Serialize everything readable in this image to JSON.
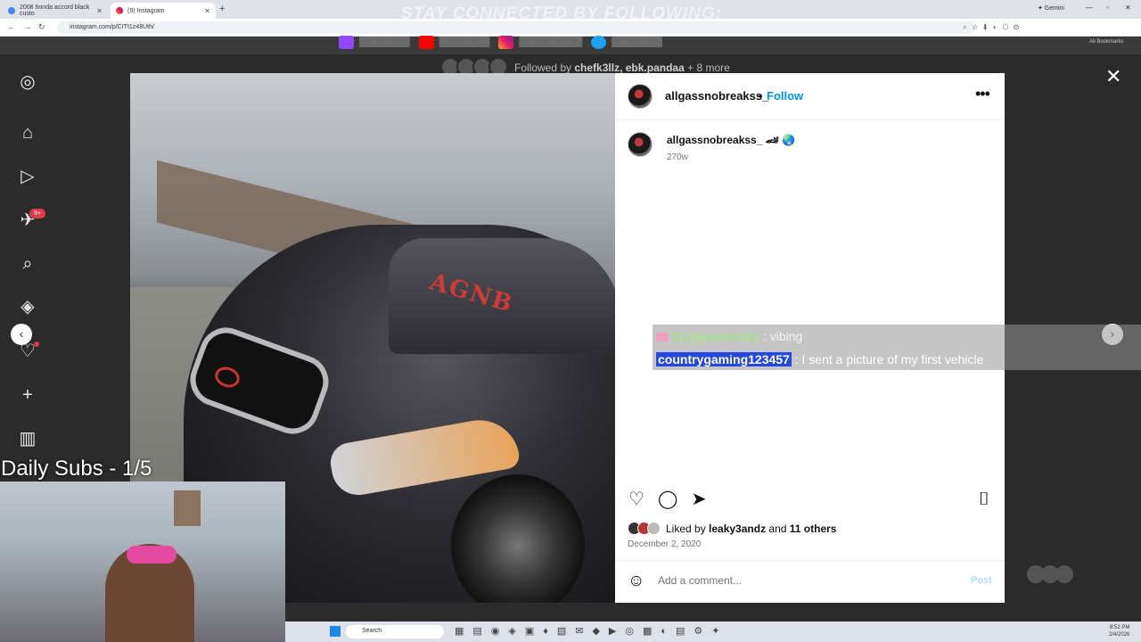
{
  "browser": {
    "tabs": [
      {
        "label": "2008 honda accord black custo"
      },
      {
        "label": "(9) Instagram"
      }
    ],
    "new_tab": "+",
    "gemini": "✦ Gemini",
    "url": "instagram.com/p/CITt1z48Uth/",
    "bookmarks": "All Bookmarks"
  },
  "overlay": {
    "banner": "STAY CONNECTED BY FOLLOWING:",
    "subs": "Daily Subs - 1/5",
    "chat": [
      {
        "user": "lizzyyyquecrazy",
        "sep": " : ",
        "msg": "vibing"
      },
      {
        "user": "countrygaming123457",
        "sep": " : ",
        "msg": "I sent a picture of my first vehicle"
      }
    ]
  },
  "background": {
    "followed_prefix": "Followed by ",
    "followed_names": "chefk3llz, ebk.pandaa",
    "followed_more": " + 8 more"
  },
  "sidebar": {
    "notif_badge": "9+"
  },
  "post": {
    "decal": "AGNB",
    "username": "allgassnobreakss_",
    "dot": "•",
    "follow": "Follow",
    "more": "•••",
    "caption_user": "allgassnobreakss_ 🏎 🌏",
    "caption_time": "270w",
    "liked_prefix": "Liked by ",
    "liked_user": "leaky3andz",
    "liked_and": " and ",
    "liked_others": "11 others",
    "date": "December 2, 2020",
    "comment_placeholder": "Add a comment...",
    "post_button": "Post"
  },
  "taskbar": {
    "search": "Search",
    "time": "8:52 PM",
    "date": "2/4/2026"
  },
  "colors": {
    "ig_blue": "#0095f6",
    "badge_red": "#e03a4a",
    "chat_user1": "#9ef07a",
    "chat_user2_bg": "#2448e0"
  },
  "icons": {
    "sidebar": [
      "instagram-icon",
      "home-icon",
      "reels-icon",
      "messages-icon",
      "search-icon",
      "explore-icon",
      "notifications-icon",
      "create-icon",
      "dashboard-icon"
    ],
    "actions": [
      "heart-icon",
      "comment-icon",
      "share-icon",
      "bookmark-icon"
    ]
  }
}
